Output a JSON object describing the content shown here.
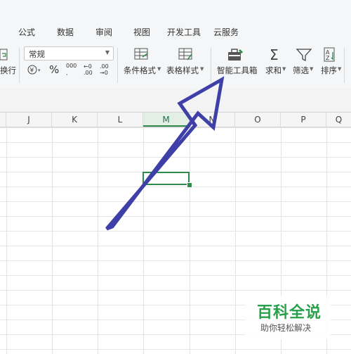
{
  "menu": {
    "tabs": [
      "公式",
      "数据",
      "审阅",
      "视图",
      "开发工具",
      "云服务"
    ]
  },
  "ribbon": {
    "wrap_label": "换行",
    "number_format": "常规",
    "percent": "%",
    "thousands": "000",
    "dec_inc": "←0 .00",
    "dec_dec": ".00 →0",
    "conditional_format": "条件格式",
    "table_style": "表格样式",
    "smart_toolbox": "智能工具箱",
    "sum": "求和",
    "filter": "筛选",
    "sort": "排序"
  },
  "sheet": {
    "columns": [
      "J",
      "K",
      "L",
      "M",
      "N",
      "O",
      "P",
      "Q"
    ],
    "selected_column": "M"
  },
  "watermark": {
    "title": "百科全说",
    "subtitle": "助你轻松解决"
  },
  "colors": {
    "accent_green": "#2e8b4c",
    "arrow": "#3f3fa8",
    "watermark_green": "#27a04a"
  }
}
